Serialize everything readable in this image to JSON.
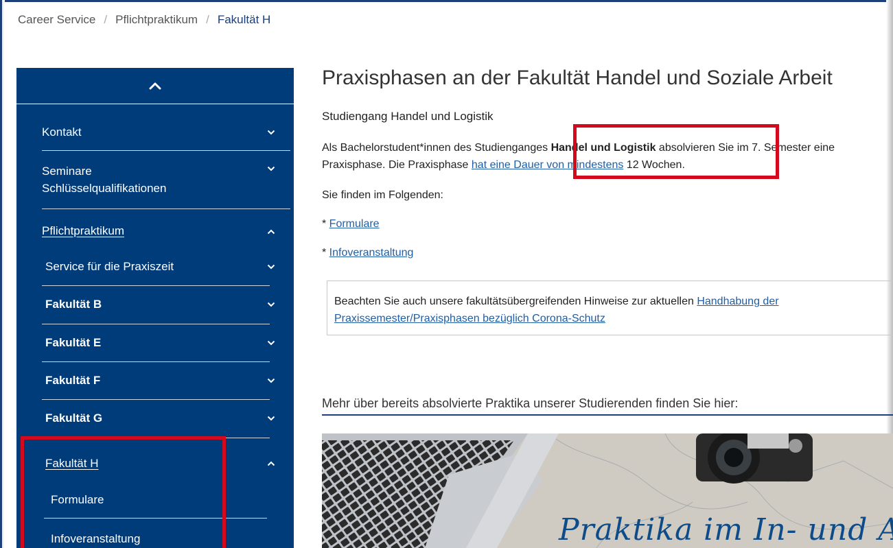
{
  "breadcrumb": {
    "items": [
      "Career Service",
      "Pflichtpraktikum",
      "Fakultät H"
    ],
    "separator": "/"
  },
  "sidebar": {
    "collapse_icon": "chevron-up-icon",
    "items": [
      {
        "label": "Kontakt",
        "state": "collapsed"
      },
      {
        "label": "Seminare Schlüsselqualifikationen",
        "line1": "Seminare",
        "line2": "Schlüsselqualifikationen",
        "state": "collapsed"
      },
      {
        "label": "Pflichtpraktikum",
        "state": "expanded"
      },
      {
        "label": "Service für die Praxiszeit",
        "state": "collapsed"
      },
      {
        "label": "Fakultät B",
        "state": "collapsed"
      },
      {
        "label": "Fakultät E",
        "state": "collapsed"
      },
      {
        "label": "Fakultät F",
        "state": "collapsed"
      },
      {
        "label": "Fakultät G",
        "state": "collapsed"
      },
      {
        "label": "Fakultät H",
        "state": "expanded"
      },
      {
        "label": "Formulare"
      },
      {
        "label": "Infoveranstaltung"
      }
    ]
  },
  "main": {
    "title": "Praxisphasen an der Fakultät Handel und Soziale Arbeit",
    "subtitle": "Studiengang Handel und Logistik",
    "intro": {
      "part1": "Als Bachelorstudent*innen des Studienganges ",
      "bold": "Handel und Logistik",
      "part2": " absolvieren Sie im 7. Semester eine Praxisphase. Die Praxisphase ",
      "link": "hat eine Dauer von mindestens",
      "part3": " 12 Wochen."
    },
    "following": "Sie finden im Folgenden:",
    "bullets": [
      {
        "prefix": "* ",
        "label": "Formulare"
      },
      {
        "prefix": "* ",
        "label": "Infoveranstaltung"
      }
    ],
    "notice": {
      "text": "Beachten Sie auch unsere fakultätsübergreifenden Hinweise zur aktuellen ",
      "link": "Handhabung der Praxissemester/Praxisphasen bezüglich Corona-Schutz"
    },
    "more_heading": "Mehr über bereits absolvierte Praktika unserer Studierenden finden Sie hier:",
    "image_caption": "Praktika im In- und Ausland"
  },
  "colors": {
    "sidebar_bg": "#003b7a",
    "link": "#1f5ea6",
    "highlight": "#d10a1e",
    "breadcrumb_current": "#1a3e75"
  }
}
